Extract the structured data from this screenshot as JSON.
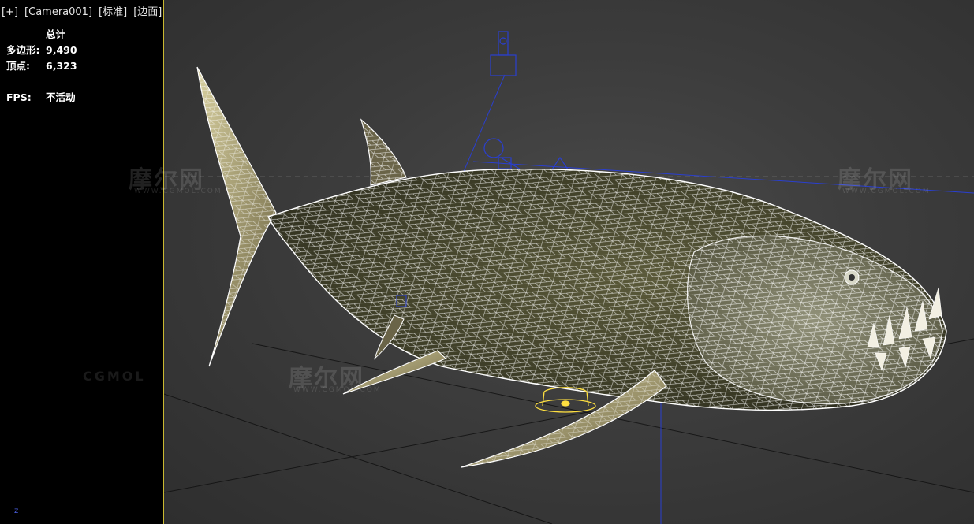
{
  "viewport": {
    "labels": [
      "[+]",
      "[Camera001]",
      "[标准]",
      "[边面]"
    ]
  },
  "stats": {
    "title": "总计",
    "polygons_label": "多边形:",
    "polygons_value": "9,490",
    "vertices_label": "顶点:",
    "vertices_value": "6,323",
    "fps_label": "FPS:",
    "fps_value": "不活动"
  },
  "axis_label": "z",
  "watermarks": {
    "brand": "摩尔网",
    "sub": "WWW.CGMOL.COM",
    "cgmol": "CGMOL"
  },
  "colors": {
    "frame": "#c9b830",
    "selection": "#ffe040",
    "helper": "#2a3fd0",
    "wire": "#ffffff",
    "fish_body": "#4a4a2e"
  },
  "icons": [
    "camera-gizmo",
    "pivot-gizmo",
    "ground-grid",
    "fish-wireframe"
  ]
}
